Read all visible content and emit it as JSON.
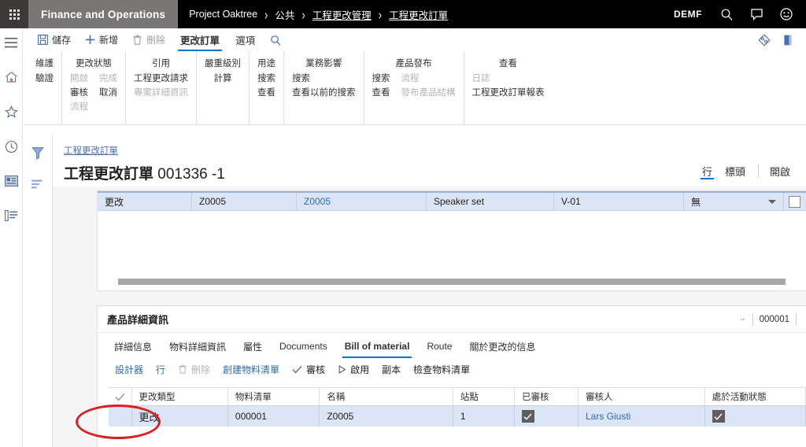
{
  "topbar": {
    "app_title": "Finance and Operations",
    "breadcrumb": [
      {
        "label": "Project Oaktree",
        "link": false
      },
      {
        "label": "公共",
        "link": false
      },
      {
        "label": "工程更改管理",
        "link": true
      },
      {
        "label": "工程更改訂單",
        "link": true
      }
    ],
    "separator": "›",
    "company": "DEMF",
    "icons": [
      "search-icon",
      "feedback-icon",
      "help-icon"
    ],
    "waffle": "app-launcher-icon"
  },
  "leftrail": {
    "items": [
      {
        "name": "hamburger-menu-icon"
      },
      {
        "name": "home-icon"
      },
      {
        "name": "favorites-star-icon"
      },
      {
        "name": "recent-clock-icon"
      },
      {
        "name": "workspaces-icon"
      },
      {
        "name": "modules-list-icon"
      }
    ]
  },
  "actionpane": {
    "commands": [
      {
        "label": "儲存",
        "icon": "save-icon",
        "disabled": false
      },
      {
        "label": "新增",
        "icon": "plus-icon",
        "disabled": false
      },
      {
        "label": "刪除",
        "icon": "delete-trash-icon",
        "disabled": true
      }
    ],
    "tabs": [
      {
        "label": "更改訂單",
        "active": true
      },
      {
        "label": "選項",
        "active": false
      }
    ],
    "search_icon": "search-icon",
    "right_icons": [
      "personalize-icon",
      "attachment-icon"
    ],
    "groups": [
      {
        "title": "維護",
        "columns": [
          {
            "items": [
              {
                "label": "驗證",
                "disabled": false
              }
            ]
          }
        ]
      },
      {
        "title": "更改狀態",
        "columns": [
          {
            "items": [
              {
                "label": "開啟",
                "disabled": true
              },
              {
                "label": "審核",
                "disabled": false
              },
              {
                "label": "流程",
                "disabled": true
              }
            ]
          },
          {
            "items": [
              {
                "label": "完成",
                "disabled": true
              },
              {
                "label": "取消",
                "disabled": false
              }
            ]
          }
        ]
      },
      {
        "title": "引用",
        "columns": [
          {
            "items": [
              {
                "label": "工程更改請求",
                "disabled": false
              },
              {
                "label": "專案詳細資訊",
                "disabled": true
              }
            ]
          }
        ]
      },
      {
        "title": "嚴重級別",
        "columns": [
          {
            "items": [
              {
                "label": "計算",
                "disabled": false
              }
            ]
          }
        ]
      },
      {
        "title": "用途",
        "columns": [
          {
            "items": [
              {
                "label": "搜索",
                "disabled": false
              },
              {
                "label": "查看",
                "disabled": false
              }
            ]
          }
        ]
      },
      {
        "title": "業務影響",
        "columns": [
          {
            "items": [
              {
                "label": "搜索",
                "disabled": false
              },
              {
                "label": "查看以前的搜索",
                "disabled": false
              }
            ]
          }
        ]
      },
      {
        "title": "產品發布",
        "columns": [
          {
            "items": [
              {
                "label": "搜索",
                "disabled": false
              },
              {
                "label": "查看",
                "disabled": false
              }
            ]
          },
          {
            "items": [
              {
                "label": "流程",
                "disabled": true
              },
              {
                "label": "發布產品結構",
                "disabled": true
              }
            ]
          }
        ]
      },
      {
        "title": "查看",
        "columns": [
          {
            "items": [
              {
                "label": "日誌",
                "disabled": true
              },
              {
                "label": "工程更改訂單報表",
                "disabled": false
              }
            ]
          }
        ]
      }
    ]
  },
  "filterrail": {
    "items": [
      {
        "name": "filter-funnel-icon"
      },
      {
        "name": "view-options-icon"
      }
    ]
  },
  "page": {
    "crumb": "工程更改訂單",
    "title": "工程更改訂單",
    "title_number": "001336 -1",
    "view_tabs": [
      {
        "label": "行",
        "active": true
      },
      {
        "label": "標頭",
        "active": false
      }
    ],
    "open_label": "開啟"
  },
  "header_grid": {
    "row": {
      "change_type": "更改",
      "col2": "Z0005",
      "col3": "Z0005",
      "name": "Speaker set",
      "version": "V-01",
      "status": "無",
      "checkbox_checked": false
    },
    "scrollbar": "horizontal-scrollbar"
  },
  "lower": {
    "title": "產品詳細資訊",
    "nav_dash": "··",
    "record_id": "000001",
    "tabs": [
      {
        "label": "詳細信息",
        "active": false
      },
      {
        "label": "物料詳細資訊",
        "active": false
      },
      {
        "label": "屬性",
        "active": false
      },
      {
        "label": "Documents",
        "active": false
      },
      {
        "label": "Bill of material",
        "active": true
      },
      {
        "label": "Route",
        "active": false
      },
      {
        "label": "關於更改的信息",
        "active": false
      }
    ],
    "toolbar": [
      {
        "label": "設計器",
        "icon": null,
        "style": "link"
      },
      {
        "label": "行",
        "icon": null,
        "style": "link"
      },
      {
        "label": "刪除",
        "icon": "delete-trash-icon",
        "style": "disabled"
      },
      {
        "label": "創建物料清單",
        "icon": null,
        "style": "link"
      },
      {
        "label": "審核",
        "icon": "check-icon",
        "style": "dark"
      },
      {
        "label": "啟用",
        "icon": "play-triangle-icon",
        "style": "dark"
      },
      {
        "label": "副本",
        "icon": null,
        "style": "dark"
      },
      {
        "label": "檢查物料清單",
        "icon": null,
        "style": "dark"
      }
    ],
    "table": {
      "columns": [
        "更改類型",
        "物料清單",
        "名稱",
        "站點",
        "已審核",
        "審核人",
        "處於活動狀態"
      ],
      "header_check_icon": "check-icon",
      "rows": [
        {
          "change_type": "更改",
          "bom": "000001",
          "name": "Z0005",
          "site": "1",
          "approved": true,
          "approved_by": "Lars Giusti",
          "active": true
        }
      ]
    }
  },
  "annotation": {
    "highlight": "red-ellipse-highlight"
  },
  "colors": {
    "accent": "#0078d4",
    "link": "#2f6ab5",
    "row_selected": "#dce5f5",
    "topbar_bg": "#000000",
    "app_title_bg": "#797775",
    "highlight": "#d92121"
  }
}
